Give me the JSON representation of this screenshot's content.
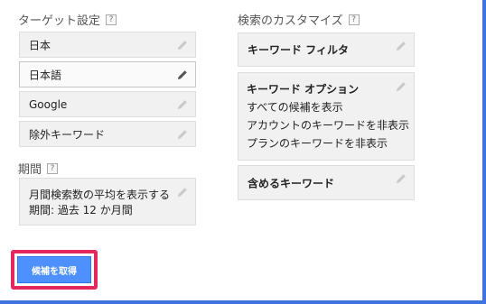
{
  "targeting": {
    "title": "ターゲット設定",
    "help": "?",
    "fields": [
      {
        "label": "日本"
      },
      {
        "label": "日本語"
      },
      {
        "label": "Google"
      },
      {
        "label": "除外キーワード"
      }
    ]
  },
  "period": {
    "title": "期間",
    "help": "?",
    "line1": "月間検索数の平均を表示する",
    "line2": "期間: 過去 12 か月間"
  },
  "customize": {
    "title": "検索のカスタマイズ",
    "help": "?",
    "keyword_filter": "キーワード フィルタ",
    "keyword_options": {
      "title": "キーワード オプション",
      "items": [
        "すべての候補を表示",
        "アカウントのキーワードを非表示",
        "プランのキーワードを非表示"
      ]
    },
    "include_keywords": "含めるキーワード"
  },
  "get_ideas_button": "候補を取得",
  "colors": {
    "frame": "#3f74e0",
    "button": "#4d90fe",
    "highlight": "#e2285c"
  }
}
